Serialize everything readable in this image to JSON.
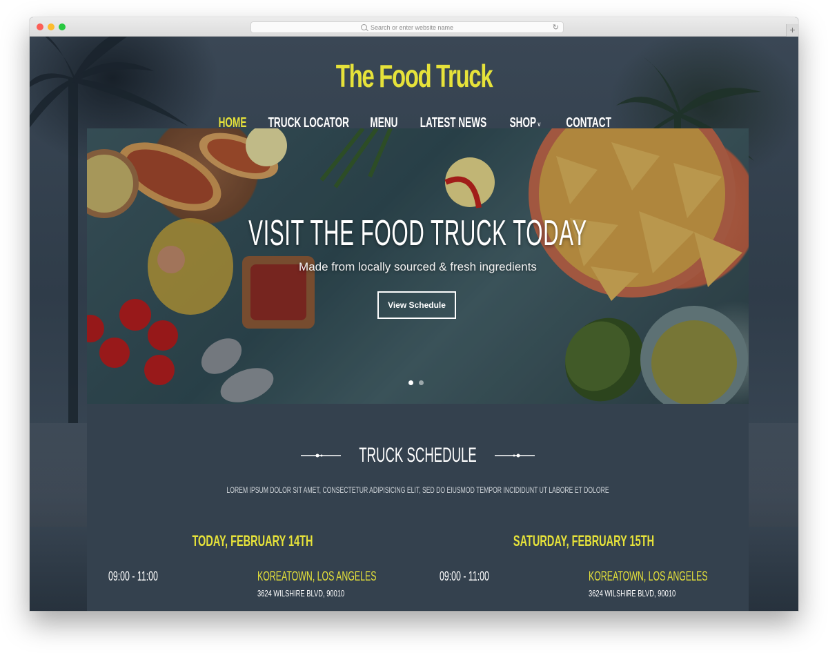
{
  "browser": {
    "url_placeholder": "Search or enter website name",
    "reload_icon": "reload-icon",
    "new_tab_label": "+"
  },
  "site": {
    "logo": "The Food Truck",
    "colors": {
      "accent": "#e6e23a",
      "background": "#2b3845",
      "panel": "#34414e"
    }
  },
  "nav": {
    "items": [
      {
        "label": "Home",
        "active": true
      },
      {
        "label": "Truck Locator",
        "active": false
      },
      {
        "label": "Menu",
        "active": false
      },
      {
        "label": "Latest News",
        "active": false
      },
      {
        "label": "Shop",
        "active": false,
        "has_dropdown": true
      },
      {
        "label": "Contact",
        "active": false
      }
    ],
    "dropdown_icon": "chevron-down-icon"
  },
  "hero": {
    "title": "Visit the Food Truck Today",
    "subtitle": "Made from locally sourced & fresh ingredients",
    "button_label": "View Schedule",
    "slides_total": 2,
    "active_slide": 1
  },
  "schedule": {
    "title": "Truck Schedule",
    "lead": "Lorem ipsum dolor sit amet, consectetur adipisicing elit, sed do eiusmod tempor incididunt ut labore et dolore",
    "days": [
      {
        "title": "Today, February 14th",
        "time": "09:00 - 11:00",
        "place": "Koreatown, Los Angeles",
        "address": "3624 Wilshire Blvd, 90010"
      },
      {
        "title": "Saturday, February 15th",
        "time": "09:00 - 11:00",
        "place": "Koreatown, Los Angeles",
        "address": "3624 Wilshire Blvd, 90010"
      }
    ]
  }
}
